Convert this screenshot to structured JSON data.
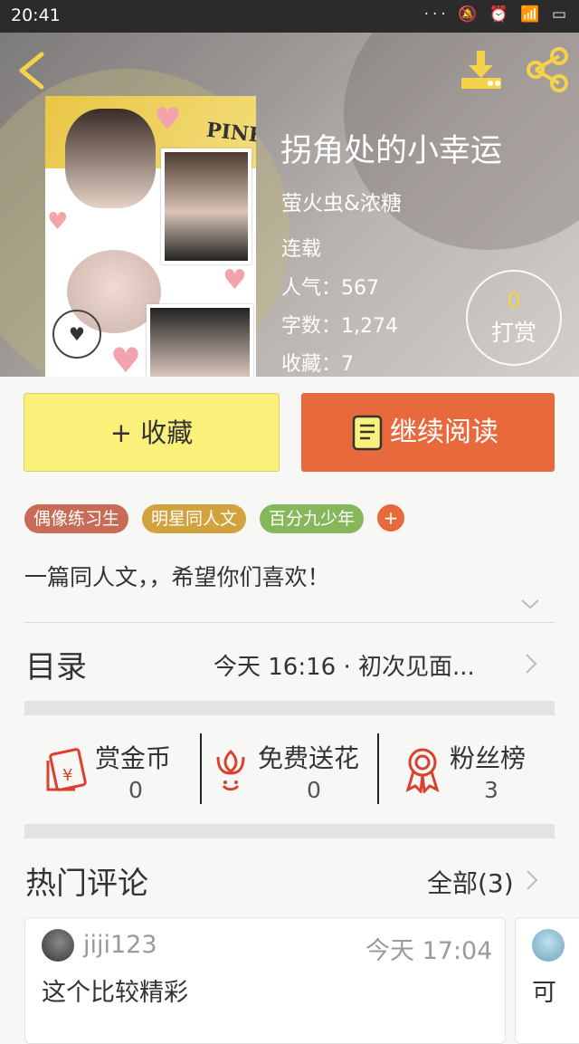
{
  "status_bar": {
    "time": "20:41",
    "icons": [
      "dots-icon",
      "mute-icon",
      "alarm-icon",
      "wifi-icon",
      "signal-icon",
      "battery-icon"
    ]
  },
  "header": {
    "back_icon": "chevron-left-icon",
    "download_icon": "download-icon",
    "share_icon": "share-icon",
    "icon_color": "#f5d24a"
  },
  "book": {
    "title": "拐角处的小幸运",
    "author": "萤火虫&浓糖",
    "status": "连载",
    "stats": [
      {
        "label": "人气：",
        "value": "567"
      },
      {
        "label": "字数：",
        "value": "1,274"
      },
      {
        "label": "收藏：",
        "value": "7"
      }
    ],
    "cover_text": "PINK"
  },
  "tip": {
    "count": "0",
    "label": "打赏"
  },
  "actions": {
    "favorite_label": "+ 收藏",
    "read_label": "继续阅读",
    "favorite_color": "#fbf07a",
    "read_color": "#e8693b"
  },
  "tags": [
    {
      "label": "偶像练习生",
      "color": "#c86b57"
    },
    {
      "label": "明星同人文",
      "color": "#d2a23e"
    },
    {
      "label": "百分九少年",
      "color": "#86b85b"
    }
  ],
  "tag_add_label": "+",
  "description": "一篇同人文，，希望你们喜欢！",
  "toc": {
    "label": "目录",
    "latest": "今天 16:16 · 初次见面..."
  },
  "rewards": [
    {
      "label": "赏金币",
      "value": "0",
      "icon": "red-envelope-icon"
    },
    {
      "label": "免费送花",
      "value": "0",
      "icon": "flower-icon"
    },
    {
      "label": "粉丝榜",
      "value": "3",
      "icon": "award-ribbon-icon"
    }
  ],
  "comments": {
    "title": "热门评论",
    "all_label": "全部(3)",
    "items": [
      {
        "user": "jiji123",
        "time": "今天 17:04",
        "text": "这个比较精彩"
      },
      {
        "user": "",
        "time": "",
        "text": "可"
      }
    ]
  }
}
